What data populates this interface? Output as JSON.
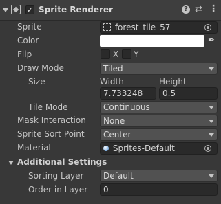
{
  "component": {
    "title": "Sprite Renderer",
    "enabled": true,
    "header_icons": [
      "help-icon",
      "preset-icon",
      "more-icon"
    ]
  },
  "fields": {
    "sprite": {
      "label": "Sprite",
      "value": "forest_tile_57"
    },
    "color": {
      "label": "Color",
      "value": "#ffffff"
    },
    "flip": {
      "label": "Flip",
      "x_label": "X",
      "y_label": "Y",
      "x": false,
      "y": false
    },
    "draw_mode": {
      "label": "Draw Mode",
      "value": "Tiled"
    },
    "size": {
      "label": "Size",
      "width_label": "Width",
      "height_label": "Height",
      "width": "7.733248",
      "height": "0.5"
    },
    "tile_mode": {
      "label": "Tile Mode",
      "value": "Continuous"
    },
    "mask_interaction": {
      "label": "Mask Interaction",
      "value": "None"
    },
    "sprite_sort_point": {
      "label": "Sprite Sort Point",
      "value": "Center"
    },
    "material": {
      "label": "Material",
      "value": "Sprites-Default"
    }
  },
  "additional": {
    "title": "Additional Settings",
    "sorting_layer": {
      "label": "Sorting Layer",
      "value": "Default"
    },
    "order_in_layer": {
      "label": "Order in Layer",
      "value": "0"
    }
  },
  "colors": {
    "background": "#383838",
    "field": "#2a2a2a",
    "dropdown": "#515151",
    "text": "#c4c4c4"
  }
}
